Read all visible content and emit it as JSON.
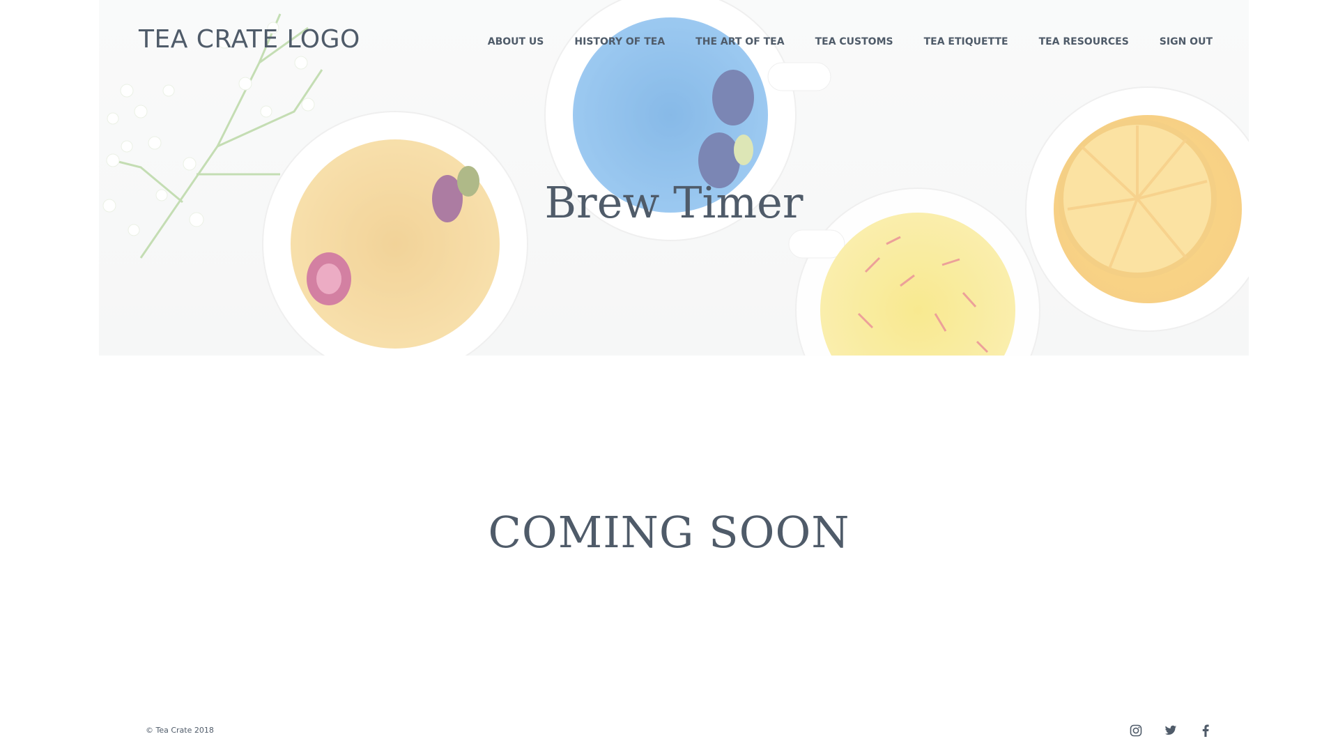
{
  "header": {
    "logo_text": "TEA CRATE LOGO",
    "nav": [
      {
        "label": "ABOUT US"
      },
      {
        "label": "HISTORY OF TEA"
      },
      {
        "label": "THE ART OF TEA"
      },
      {
        "label": "TEA CUSTOMS"
      },
      {
        "label": "TEA ETIQUETTE"
      },
      {
        "label": "TEA RESOURCES"
      },
      {
        "label": "SIGN OUT"
      }
    ]
  },
  "hero": {
    "title": "Brew Timer",
    "image": "tea-cups-photo"
  },
  "main": {
    "message": "COMING SOON"
  },
  "footer": {
    "copyright": "© Tea Crate 2018",
    "social_icons": [
      "instagram-icon",
      "twitter-icon",
      "facebook-icon"
    ]
  },
  "colors": {
    "text": "#4f5b69",
    "background": "#ffffff"
  }
}
